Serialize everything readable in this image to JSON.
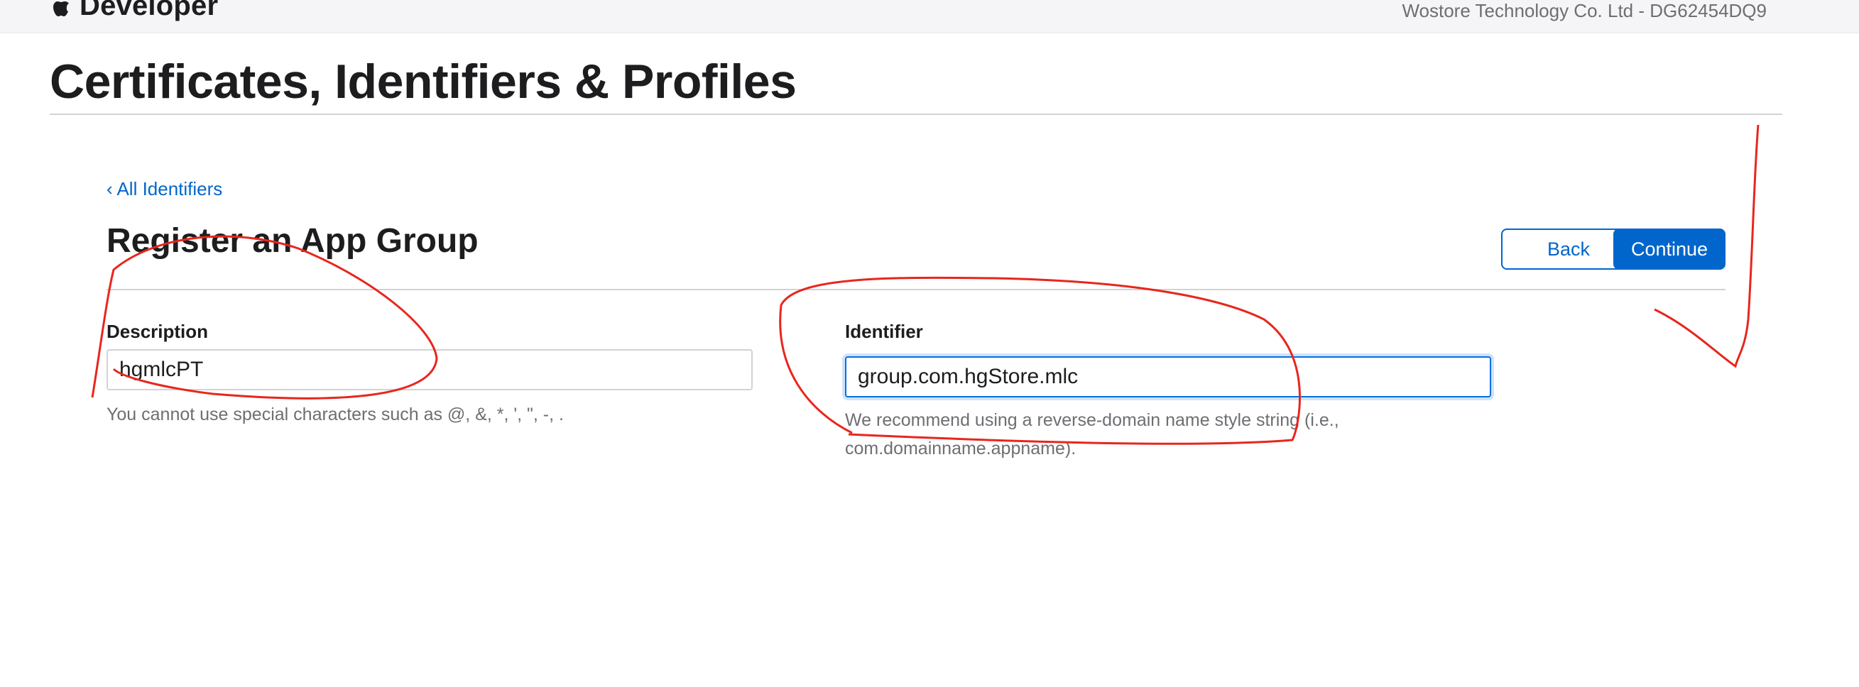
{
  "header": {
    "brand": "Developer",
    "account": "Wostore Technology Co. Ltd - DG62454DQ9"
  },
  "page": {
    "title": "Certificates, Identifiers & Profiles"
  },
  "form": {
    "back_link": "‹ All Identifiers",
    "title": "Register an App Group",
    "back_button": "Back",
    "continue_button": "Continue",
    "description": {
      "label": "Description",
      "value": "hgmlcPT",
      "hint": "You cannot use special characters such as @, &, *, ', \", -, ."
    },
    "identifier": {
      "label": "Identifier",
      "value": "group.com.hgStore.mlc",
      "hint_line1": "We recommend using a reverse-domain name style string (i.e.,",
      "hint_line2": "com.domainname.appname)."
    }
  },
  "colors": {
    "accent": "#0066cc",
    "annotation": "#e8261c"
  }
}
